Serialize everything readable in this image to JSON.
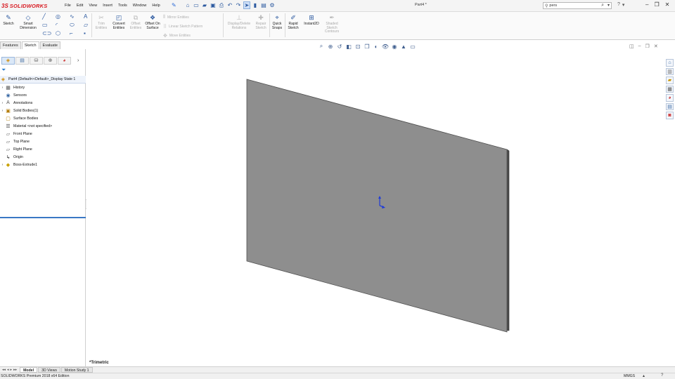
{
  "app": {
    "logo_ds": "3S",
    "logo_name": "SOLIDWORKS",
    "document_title": "Part4 *"
  },
  "menu": {
    "items": [
      "File",
      "Edit",
      "View",
      "Insert",
      "Tools",
      "Window",
      "Help"
    ]
  },
  "search": {
    "value": "pers"
  },
  "command_manager": {
    "sketch": "Sketch",
    "smart_dimension": "Smart Dimension",
    "trim_entities": "Trim Entities",
    "convert_entities": "Convert Entities",
    "offset_entities": "Offset Entities",
    "offset_on_surface": "Offset On Surface",
    "mirror_entities": "Mirror Entities",
    "linear_sketch_pattern": "Linear Sketch Pattern",
    "move_entities": "Move Entities",
    "display_delete_relations": "Display/Delete Relations",
    "repair_sketch": "Repair Sketch",
    "quick_snaps": "Quick Snaps",
    "rapid_sketch": "Rapid Sketch",
    "instant2d": "Instant2D",
    "shaded_sketch_contours": "Shaded Sketch Contours"
  },
  "tabs": [
    {
      "label": "Features",
      "active": false
    },
    {
      "label": "Sketch",
      "active": true
    },
    {
      "label": "Evaluate",
      "active": false
    }
  ],
  "feature_tree": {
    "root": "Part4  (Default<<Default>_Display State 1",
    "nodes": [
      {
        "label": "History",
        "expandable": true,
        "icon": "history-icon"
      },
      {
        "label": "Sensors",
        "expandable": false,
        "icon": "sensors-icon"
      },
      {
        "label": "Annotations",
        "expandable": true,
        "icon": "annotations-icon"
      },
      {
        "label": "Solid Bodies(1)",
        "expandable": true,
        "icon": "solid-bodies-icon"
      },
      {
        "label": "Surface Bodies",
        "expandable": false,
        "icon": "surface-bodies-icon"
      },
      {
        "label": "Material <not specified>",
        "expandable": false,
        "icon": "material-icon"
      },
      {
        "label": "Front Plane",
        "expandable": false,
        "icon": "plane-icon"
      },
      {
        "label": "Top Plane",
        "expandable": false,
        "icon": "plane-icon"
      },
      {
        "label": "Right Plane",
        "expandable": false,
        "icon": "plane-icon"
      },
      {
        "label": "Origin",
        "expandable": false,
        "icon": "origin-icon"
      },
      {
        "label": "Boss-Extrude1",
        "expandable": true,
        "icon": "boss-extrude-icon"
      }
    ]
  },
  "viewport": {
    "view_name": "*Trimetric",
    "plate_color": "#8e8e8e",
    "plate_edge_color": "#4a4a4a"
  },
  "bottom_tabs": [
    {
      "label": "Model",
      "active": true
    },
    {
      "label": "3D Views",
      "active": false
    },
    {
      "label": "Motion Study 1",
      "active": false
    }
  ],
  "status": {
    "edition": "SOLIDWORKS Premium 2018 x64 Edition",
    "units": "MMGS"
  },
  "colors": {
    "accent": "#3a78c4",
    "brand": "#d71920"
  }
}
